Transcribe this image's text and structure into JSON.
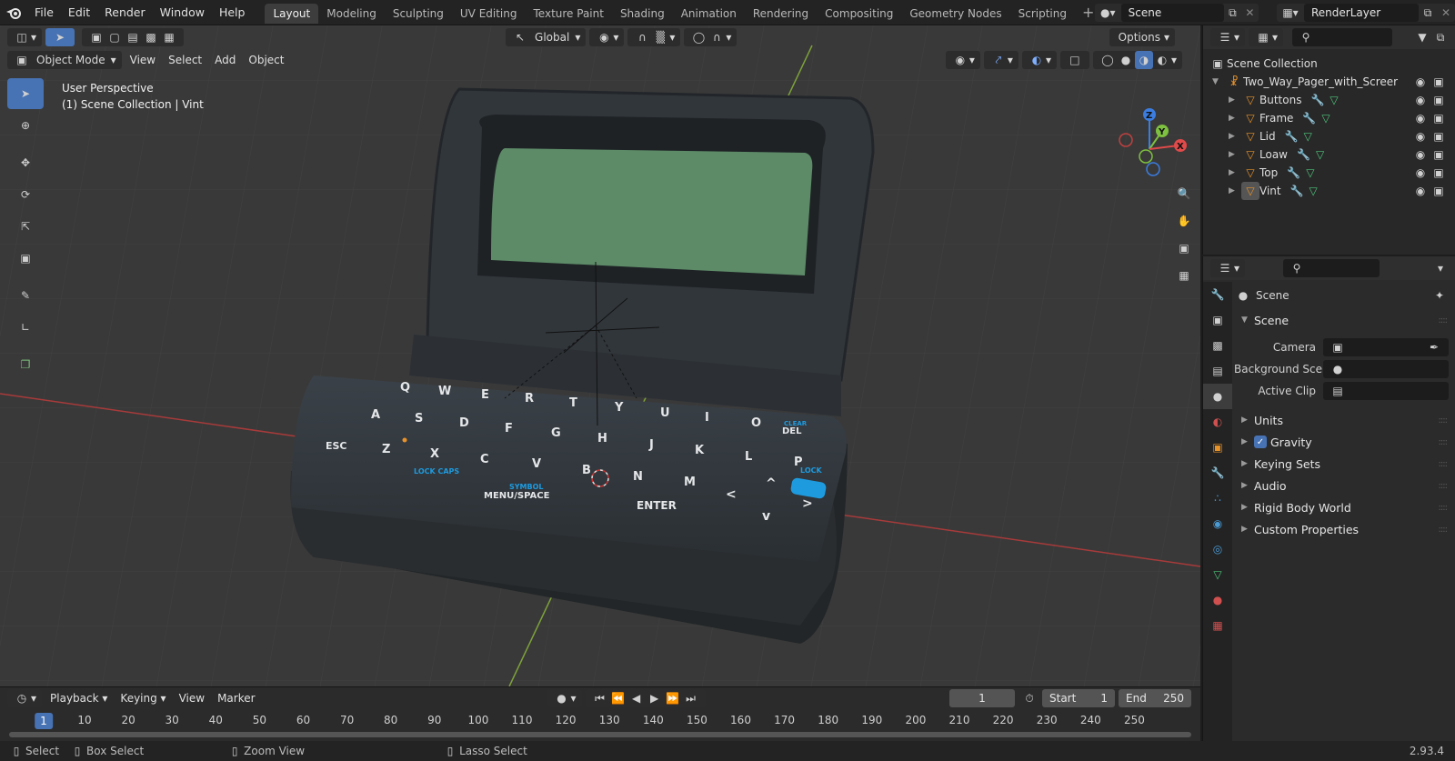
{
  "menu": [
    "File",
    "Edit",
    "Render",
    "Window",
    "Help"
  ],
  "workspaces": [
    {
      "label": "Layout",
      "active": true
    },
    {
      "label": "Modeling",
      "active": false
    },
    {
      "label": "Sculpting",
      "active": false
    },
    {
      "label": "UV Editing",
      "active": false
    },
    {
      "label": "Texture Paint",
      "active": false
    },
    {
      "label": "Shading",
      "active": false
    },
    {
      "label": "Animation",
      "active": false
    },
    {
      "label": "Rendering",
      "active": false
    },
    {
      "label": "Compositing",
      "active": false
    },
    {
      "label": "Geometry Nodes",
      "active": false
    },
    {
      "label": "Scripting",
      "active": false
    }
  ],
  "scene_name": "Scene",
  "view_layer": "RenderLayer",
  "viewport": {
    "transform_orientation": "Global",
    "options_label": "Options",
    "mode": "Object Mode",
    "menus": [
      "View",
      "Select",
      "Add",
      "Object"
    ],
    "perspective": "User Perspective",
    "collection_info": "(1) Scene Collection | Vint"
  },
  "gizmo_axes": {
    "x": "X",
    "y": "Y",
    "z": "Z"
  },
  "pager_keys": {
    "row1": [
      "Q",
      "W",
      "E",
      "R",
      "T",
      "Y",
      "U",
      "I",
      "O"
    ],
    "row2": [
      "A",
      "S",
      "D",
      "F",
      "G",
      "H",
      "J",
      "K",
      "L"
    ],
    "row3": [
      "Z",
      "X",
      "C",
      "V",
      "B",
      "N",
      "M"
    ],
    "esc": "ESC",
    "del": "DEL",
    "clear": "CLEAR",
    "p": "P",
    "lock_caps": "LOCK CAPS",
    "symbol": "SYMBOL",
    "menu_space": "MENU/SPACE",
    "enter": "ENTER",
    "lock": "LOCK"
  },
  "timeline": {
    "menus": [
      "Playback",
      "Keying",
      "View",
      "Marker"
    ],
    "current_frame": "1",
    "start_label": "Start",
    "start": "1",
    "end_label": "End",
    "end": "250",
    "ruler": [
      "10",
      "20",
      "30",
      "40",
      "50",
      "60",
      "70",
      "80",
      "90",
      "100",
      "110",
      "120",
      "130",
      "140",
      "150",
      "160",
      "170",
      "180",
      "190",
      "200",
      "210",
      "220",
      "230",
      "240",
      "250"
    ],
    "ruler_current": "1"
  },
  "status": {
    "select": "Select",
    "box_select": "Box Select",
    "zoom_view": "Zoom View",
    "lasso_select": "Lasso Select",
    "version": "2.93.4"
  },
  "outliner": {
    "root": "Scene Collection",
    "object": "Two_Way_Pager_with_Screer",
    "children": [
      "Buttons",
      "Frame",
      "Lid",
      "Loaw",
      "Top",
      "Vint"
    ]
  },
  "properties": {
    "header": "Scene",
    "panel": "Scene",
    "camera_label": "Camera",
    "background_label": "Background Sce...",
    "active_clip_label": "Active Clip",
    "subpanels": [
      "Units",
      "Gravity",
      "Keying Sets",
      "Audio",
      "Rigid Body World",
      "Custom Properties"
    ],
    "gravity_checked": true
  }
}
